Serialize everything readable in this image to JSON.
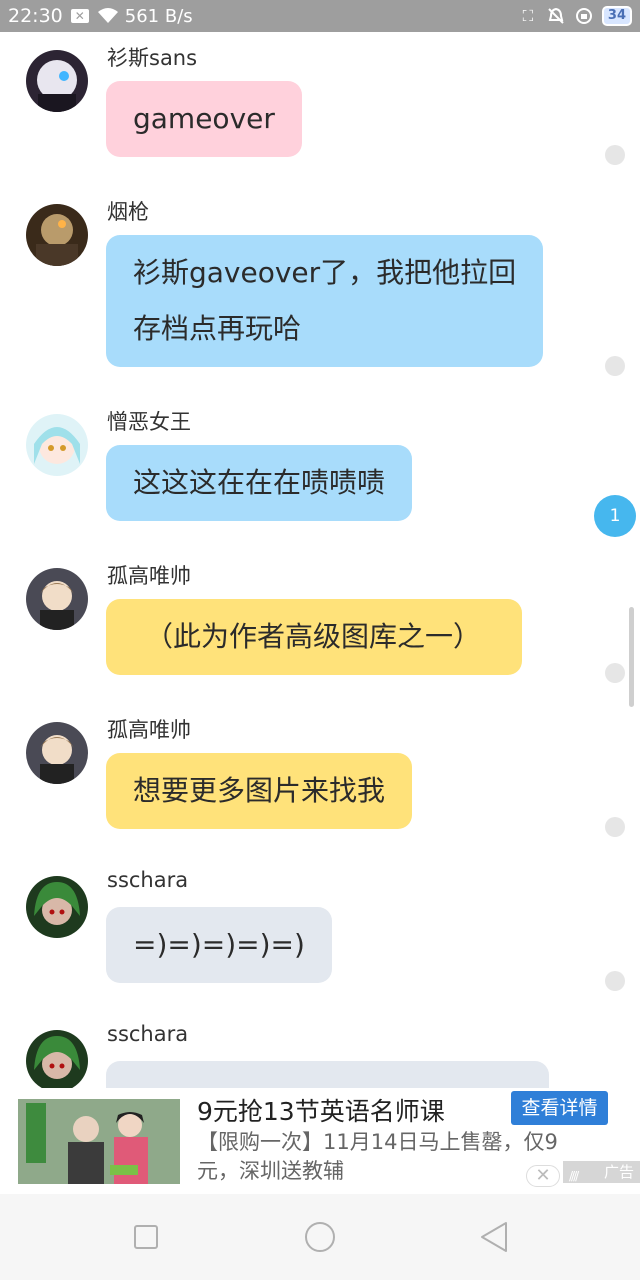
{
  "status_bar": {
    "time": "22:30",
    "network_speed": "561 B/s",
    "battery": "34",
    "icons": [
      "notification-x-icon",
      "wifi-icon",
      "nfc-icon",
      "bell-off-icon",
      "data-saver-icon"
    ]
  },
  "messages": [
    {
      "name": "衫斯sans",
      "text": "gameover",
      "bubble": "pink"
    },
    {
      "name": "烟枪",
      "text_lines": [
        "衫斯gaveover了，我把他拉回",
        "存档点再玩哈"
      ],
      "bubble": "blue"
    },
    {
      "name": "憎恶女王",
      "text": "这这这在在在啧啧啧",
      "bubble": "blue"
    },
    {
      "name": "孤高唯帅",
      "text": "（此为作者高级图库之一）",
      "bubble": "yellow"
    },
    {
      "name": "孤高唯帅",
      "text": "想要更多图片来找我",
      "bubble": "yellow"
    },
    {
      "name": "sschara",
      "text": "=)=)=)=)=)",
      "bubble": "gray"
    },
    {
      "name": "sschara",
      "text": "",
      "bubble": "gray"
    }
  ],
  "unread_badge": "1",
  "ad": {
    "title": "9元抢13节英语名师课",
    "description": "【限购一次】11月14日马上售罄，仅9元，深圳送教辅",
    "button_label": "查看详情",
    "tag": "广告"
  },
  "colors": {
    "status_bar": "#9e9e9e",
    "bubble_pink": "#ffd1dc",
    "bubble_blue": "#a8dcfb",
    "bubble_yellow": "#ffe27a",
    "bubble_gray": "#e3e8ef",
    "badge": "#46b7ee",
    "ad_button": "#2f7fd8"
  },
  "navigation": [
    "recent-apps-square-icon",
    "home-circle-icon",
    "back-triangle-icon"
  ]
}
